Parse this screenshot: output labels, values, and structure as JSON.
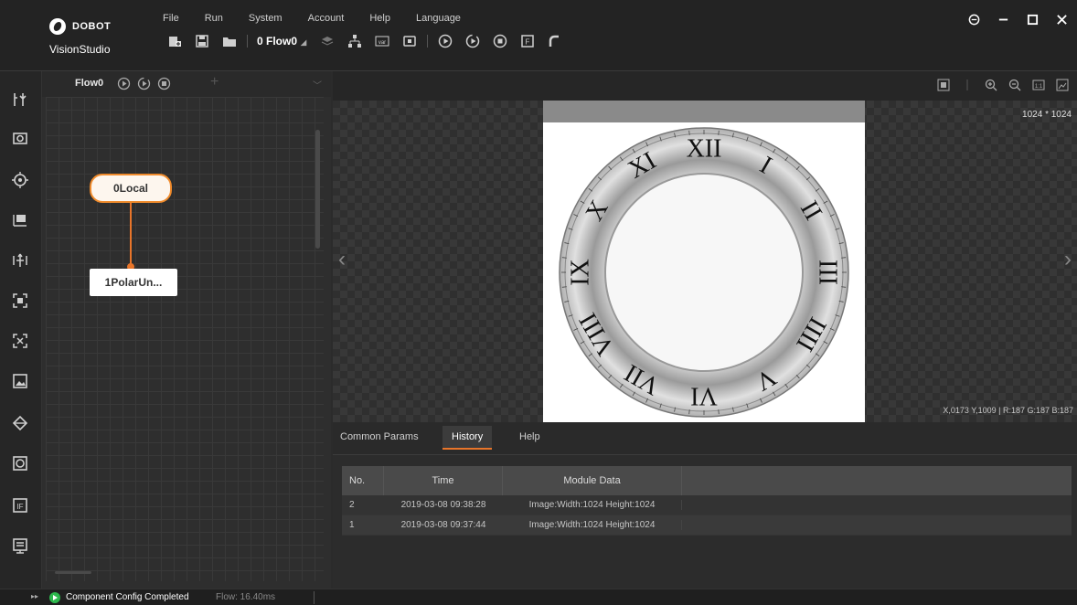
{
  "app": {
    "brand": "DOBOT",
    "product": "VisionStudio"
  },
  "menu": [
    "File",
    "Run",
    "System",
    "Account",
    "Help",
    "Language"
  ],
  "toolbar": {
    "flow_select": "0 Flow0"
  },
  "flow_panel": {
    "tab_label": "Flow0",
    "nodes": [
      {
        "label": "0Local"
      },
      {
        "label": "1PolarUn..."
      }
    ]
  },
  "viewer": {
    "resolution": "1024 * 1024",
    "coord_readout": "X,0173  Y,1009  |  R:187  G:187  B:187",
    "roman_numerals": [
      "XII",
      "I",
      "II",
      "III",
      "IIII",
      "V",
      "VI",
      "VII",
      "VIII",
      "IX",
      "X",
      "XI"
    ]
  },
  "params": {
    "tabs": [
      "Common Params",
      "History",
      "Help"
    ],
    "active_tab": "History",
    "columns": [
      "No.",
      "Time",
      "Module Data"
    ],
    "rows": [
      {
        "no": "2",
        "time": "2019-03-08 09:38:28",
        "data": "Image:Width:1024 Height:1024"
      },
      {
        "no": "1",
        "time": "2019-03-08 09:37:44",
        "data": "Image:Width:1024 Height:1024"
      }
    ]
  },
  "status": {
    "message": "Component Config Completed",
    "flow_info": "Flow: 16.40ms"
  },
  "colors": {
    "accent": "#e8752a",
    "success": "#2db84d"
  }
}
